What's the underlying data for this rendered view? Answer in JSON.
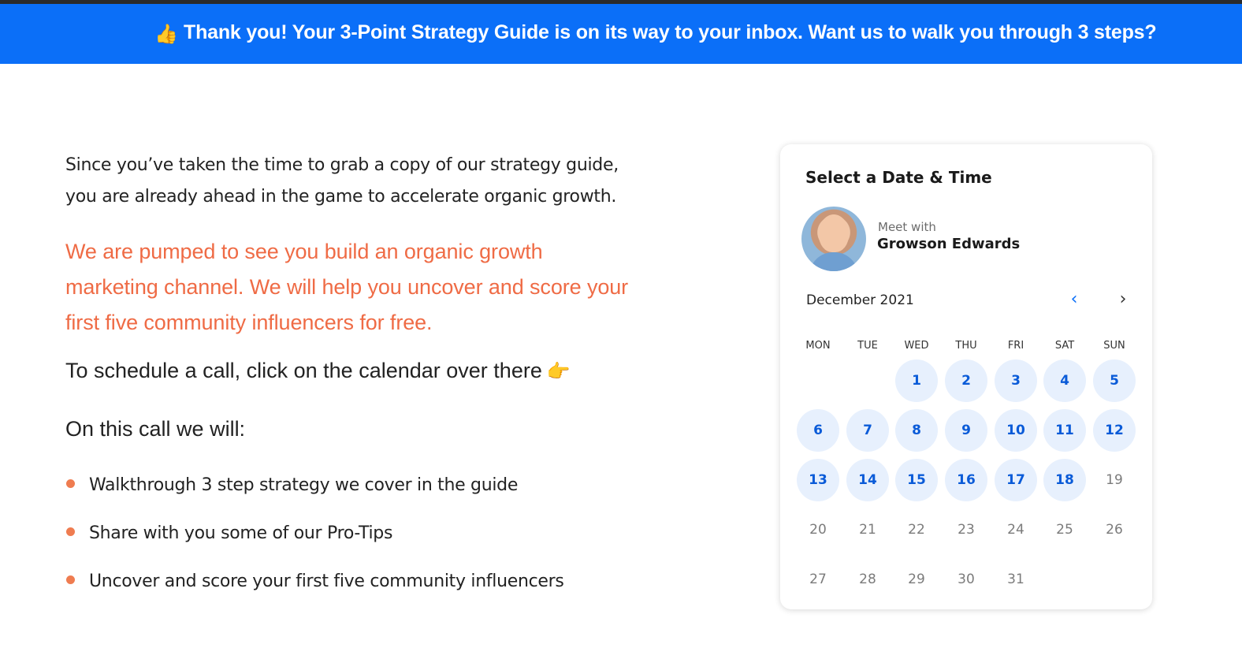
{
  "banner": {
    "icon": "thumbs-up-icon",
    "icon_glyph": "👍",
    "text": "Thank you! Your 3-Point Strategy Guide is on its way to your inbox. Want us to walk you through 3 steps?",
    "background": "#0b6ff8"
  },
  "main": {
    "intro_line1": "Since you’ve taken the time to grab a copy of our strategy guide,",
    "intro_line2": "you are already ahead in the game to accelerate organic growth.",
    "highlight_line1": "We are pumped to see you build an organic growth",
    "highlight_line2": "marketing channel. We will help you uncover and score your",
    "highlight_line3": "first five community influencers for free.",
    "highlight_color": "#ef6b45",
    "schedule_text": "To schedule a call, click on the calendar over there",
    "schedule_icon": "pointing-right-icon",
    "schedule_icon_glyph": "👉",
    "oncall_heading": "On this call we will:",
    "bullets": [
      "Walkthrough 3 step strategy we cover in the guide",
      "Share with you some of our Pro-Tips",
      "Uncover and score your first five community influencers"
    ]
  },
  "scheduler": {
    "title": "Select a Date & Time",
    "meet_label": "Meet with",
    "host_name": "Growson Edwards",
    "month": "December 2021",
    "prev_icon": "chevron-left-icon",
    "next_icon": "chevron-right-icon",
    "prev_glyph": "‹",
    "next_glyph": "›",
    "weekdays": [
      "MON",
      "TUE",
      "WED",
      "THU",
      "FRI",
      "SAT",
      "SUN"
    ],
    "first_weekday_index": 2,
    "days": [
      {
        "d": "1",
        "available": true
      },
      {
        "d": "2",
        "available": true
      },
      {
        "d": "3",
        "available": true
      },
      {
        "d": "4",
        "available": true
      },
      {
        "d": "5",
        "available": true
      },
      {
        "d": "6",
        "available": true
      },
      {
        "d": "7",
        "available": true
      },
      {
        "d": "8",
        "available": true
      },
      {
        "d": "9",
        "available": true
      },
      {
        "d": "10",
        "available": true
      },
      {
        "d": "11",
        "available": true
      },
      {
        "d": "12",
        "available": true
      },
      {
        "d": "13",
        "available": true
      },
      {
        "d": "14",
        "available": true
      },
      {
        "d": "15",
        "available": true
      },
      {
        "d": "16",
        "available": true
      },
      {
        "d": "17",
        "available": true
      },
      {
        "d": "18",
        "available": true
      },
      {
        "d": "19",
        "available": false
      },
      {
        "d": "20",
        "available": false
      },
      {
        "d": "21",
        "available": false
      },
      {
        "d": "22",
        "available": false
      },
      {
        "d": "23",
        "available": false
      },
      {
        "d": "24",
        "available": false
      },
      {
        "d": "25",
        "available": false
      },
      {
        "d": "26",
        "available": false
      },
      {
        "d": "27",
        "available": false
      },
      {
        "d": "28",
        "available": false
      },
      {
        "d": "29",
        "available": false
      },
      {
        "d": "30",
        "available": false
      },
      {
        "d": "31",
        "available": false
      }
    ],
    "available_color": "#0a5bd8",
    "available_bg": "#e7f0fd"
  }
}
